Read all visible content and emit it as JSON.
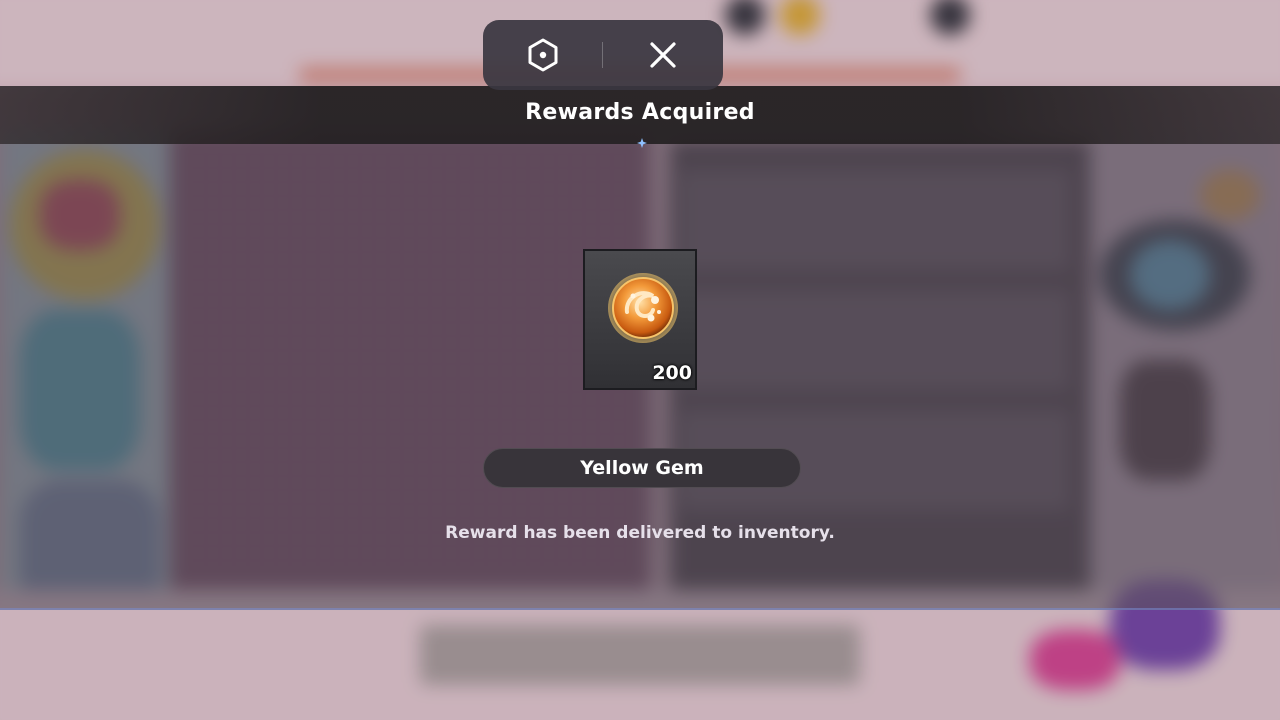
{
  "overlay": {
    "title": "Rewards Acquired",
    "reward": {
      "icon": "yellow-gem-icon",
      "quantity": "200",
      "name": "Yellow Gem"
    },
    "delivery_message": "Reward has been delivered to inventory."
  },
  "top_menu": {
    "left_icon": "roblox-menu-icon",
    "right_icon": "close-icon"
  },
  "colors": {
    "panel_header": "#262224",
    "panel_body": "#5c5260",
    "gem_orange": "#f08a24",
    "accent_spark": "#6fa8ff"
  }
}
